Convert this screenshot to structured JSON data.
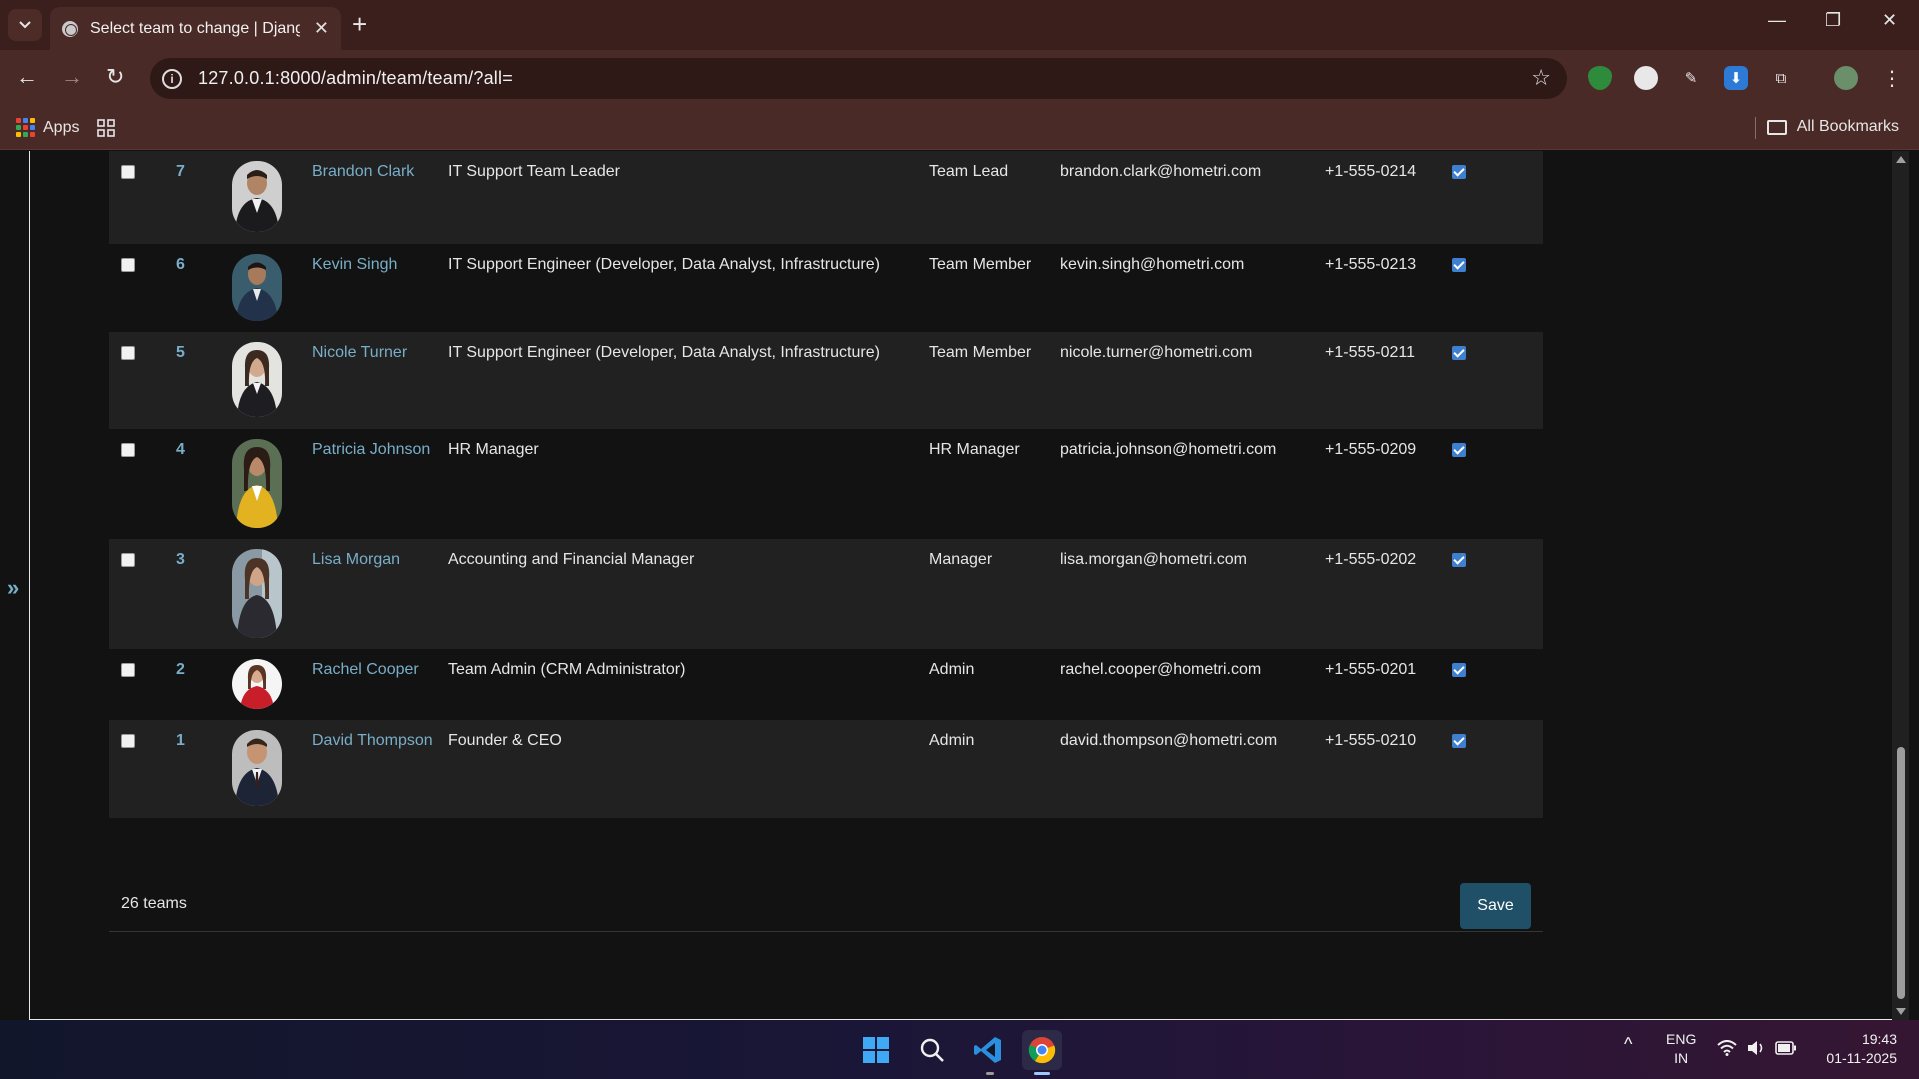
{
  "browser": {
    "tab_title": "Select team to change | Django site admin",
    "url": "127.0.0.1:8000/admin/team/team/?all=",
    "bookmarks": {
      "apps_label": "Apps",
      "all_bookmarks_label": "All Bookmarks"
    }
  },
  "table": {
    "rows": [
      {
        "id": "7",
        "name": "Brandon Clark",
        "title": "IT Support Team Leader",
        "role": "Team Lead",
        "email": "brandon.clark@hometri.com",
        "phone": "+1-555-0214",
        "active": true
      },
      {
        "id": "6",
        "name": "Kevin Singh",
        "title": "IT Support Engineer (Developer, Data Analyst, Infrastructure)",
        "role": "Team Member",
        "email": "kevin.singh@hometri.com",
        "phone": "+1-555-0213",
        "active": true
      },
      {
        "id": "5",
        "name": "Nicole Turner",
        "title": "IT Support Engineer (Developer, Data Analyst, Infrastructure)",
        "role": "Team Member",
        "email": "nicole.turner@hometri.com",
        "phone": "+1-555-0211",
        "active": true
      },
      {
        "id": "4",
        "name": "Patricia Johnson",
        "title": "HR Manager",
        "role": "HR Manager",
        "email": "patricia.johnson@hometri.com",
        "phone": "+1-555-0209",
        "active": true
      },
      {
        "id": "3",
        "name": "Lisa Morgan",
        "title": "Accounting and Financial Manager",
        "role": "Manager",
        "email": "lisa.morgan@hometri.com",
        "phone": "+1-555-0202",
        "active": true
      },
      {
        "id": "2",
        "name": "Rachel Cooper",
        "title": "Team Admin (CRM Administrator)",
        "role": "Admin",
        "email": "rachel.cooper@hometri.com",
        "phone": "+1-555-0201",
        "active": true
      },
      {
        "id": "1",
        "name": "David Thompson",
        "title": "Founder & CEO",
        "role": "Admin",
        "email": "david.thompson@hometri.com",
        "phone": "+1-555-0210",
        "active": true
      }
    ]
  },
  "paginator": {
    "count_text": "26 teams",
    "save_label": "Save"
  },
  "taskbar": {
    "lang_top": "ENG",
    "lang_bottom": "IN",
    "time": "19:43",
    "date": "01-11-2025"
  },
  "colors": {
    "link": "#79aec8",
    "button": "#205067",
    "chrome": "#4a2a27"
  }
}
